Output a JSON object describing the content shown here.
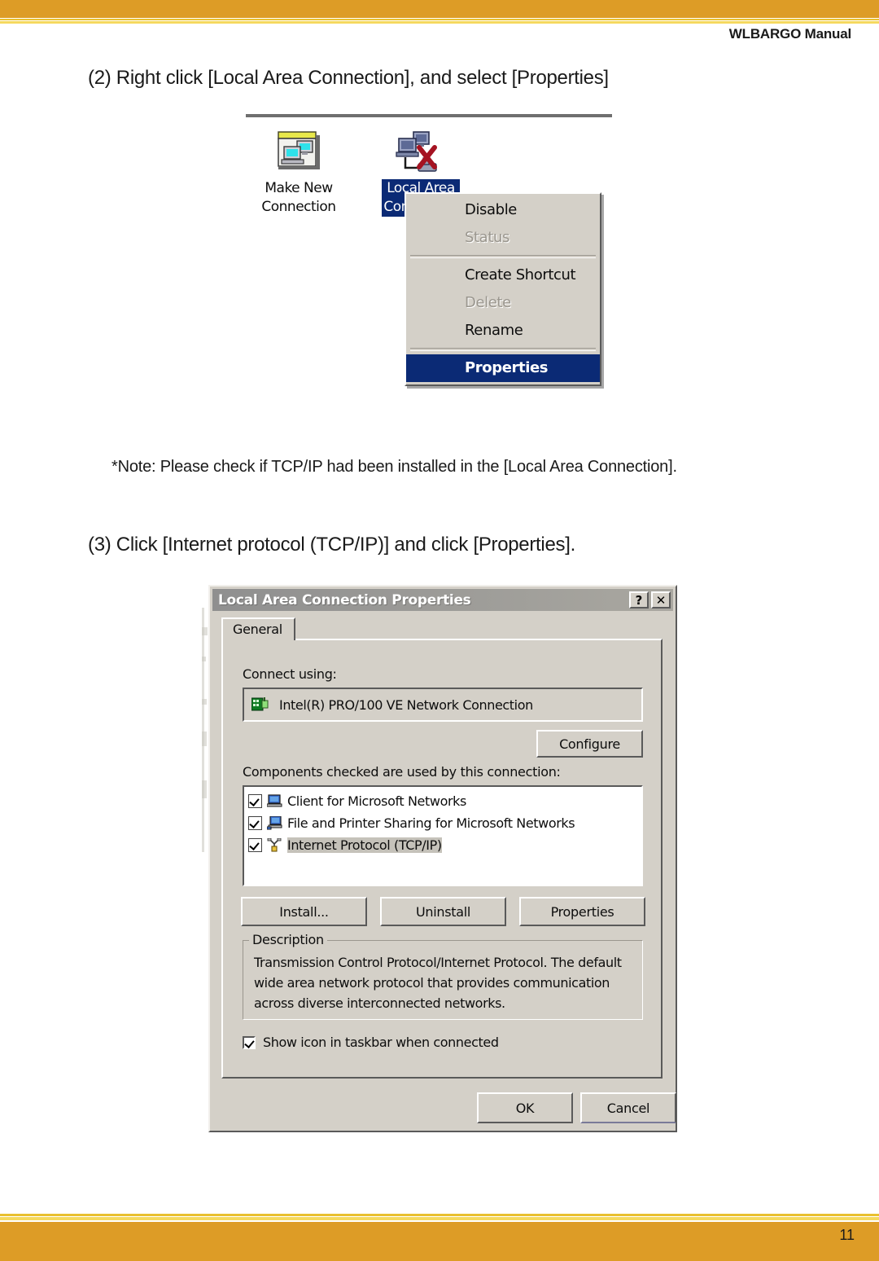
{
  "page": {
    "running_header": "WLBARGO Manual",
    "page_number": "11",
    "accent_color": "#dd9c26",
    "accent_stripe_color": "#f5d95e"
  },
  "body_text": {
    "step2_heading": "(2) Right click [Local Area Connection], and select [Properties]",
    "note": "*Note: Please check if TCP/IP had been installed in the [Local Area Connection].",
    "step3_heading": "(3) Click [Internet protocol (TCP/IP)] and click [Properties]."
  },
  "figure_connections": {
    "items": [
      {
        "label_line1": "Make New",
        "label_line2": "Connection",
        "icon": "make-new-connection-icon",
        "selected": false
      },
      {
        "label_line1": "Local Area",
        "label_line2": "Connection",
        "icon": "local-area-connection-icon",
        "selected": true
      }
    ],
    "context_menu": {
      "items": [
        {
          "label": "Disable",
          "state": "normal"
        },
        {
          "label": "Status",
          "state": "disabled"
        },
        {
          "separator": true
        },
        {
          "label": "Create Shortcut",
          "state": "normal"
        },
        {
          "label": "Delete",
          "state": "disabled"
        },
        {
          "label": "Rename",
          "state": "normal"
        },
        {
          "separator": true
        },
        {
          "label": "Properties",
          "state": "highlighted"
        }
      ],
      "highlight_color": "#0b2a75"
    }
  },
  "dialog": {
    "title": "Local Area Connection Properties",
    "title_buttons": [
      {
        "name": "help-button",
        "glyph": "?"
      },
      {
        "name": "close-button",
        "glyph": "✕"
      }
    ],
    "tabs": [
      {
        "label": "General",
        "active": true
      }
    ],
    "connect_using": {
      "label": "Connect using:",
      "adapter": "Intel(R) PRO/100 VE Network Connection",
      "configure_button": "Configure"
    },
    "components": {
      "label": "Components checked are used by this connection:",
      "items": [
        {
          "label": "Client for Microsoft Networks",
          "checked": true,
          "selected": false,
          "icon": "computer-icon"
        },
        {
          "label": "File and Printer Sharing for Microsoft Networks",
          "checked": true,
          "selected": false,
          "icon": "file-printer-sharing-icon"
        },
        {
          "label": "Internet Protocol (TCP/IP)",
          "checked": true,
          "selected": true,
          "icon": "protocol-icon"
        }
      ],
      "buttons": [
        {
          "label": "Install...",
          "name": "install-button"
        },
        {
          "label": "Uninstall",
          "name": "uninstall-button"
        },
        {
          "label": "Properties",
          "name": "properties-button"
        }
      ]
    },
    "description": {
      "legend": "Description",
      "text": "Transmission Control Protocol/Internet Protocol. The default wide area network protocol that provides communication across diverse interconnected networks."
    },
    "show_icon": {
      "label": "Show icon in taskbar when connected",
      "checked": true
    },
    "footer_buttons": [
      {
        "label": "OK",
        "name": "ok-button"
      },
      {
        "label": "Cancel",
        "name": "cancel-button"
      }
    ]
  }
}
